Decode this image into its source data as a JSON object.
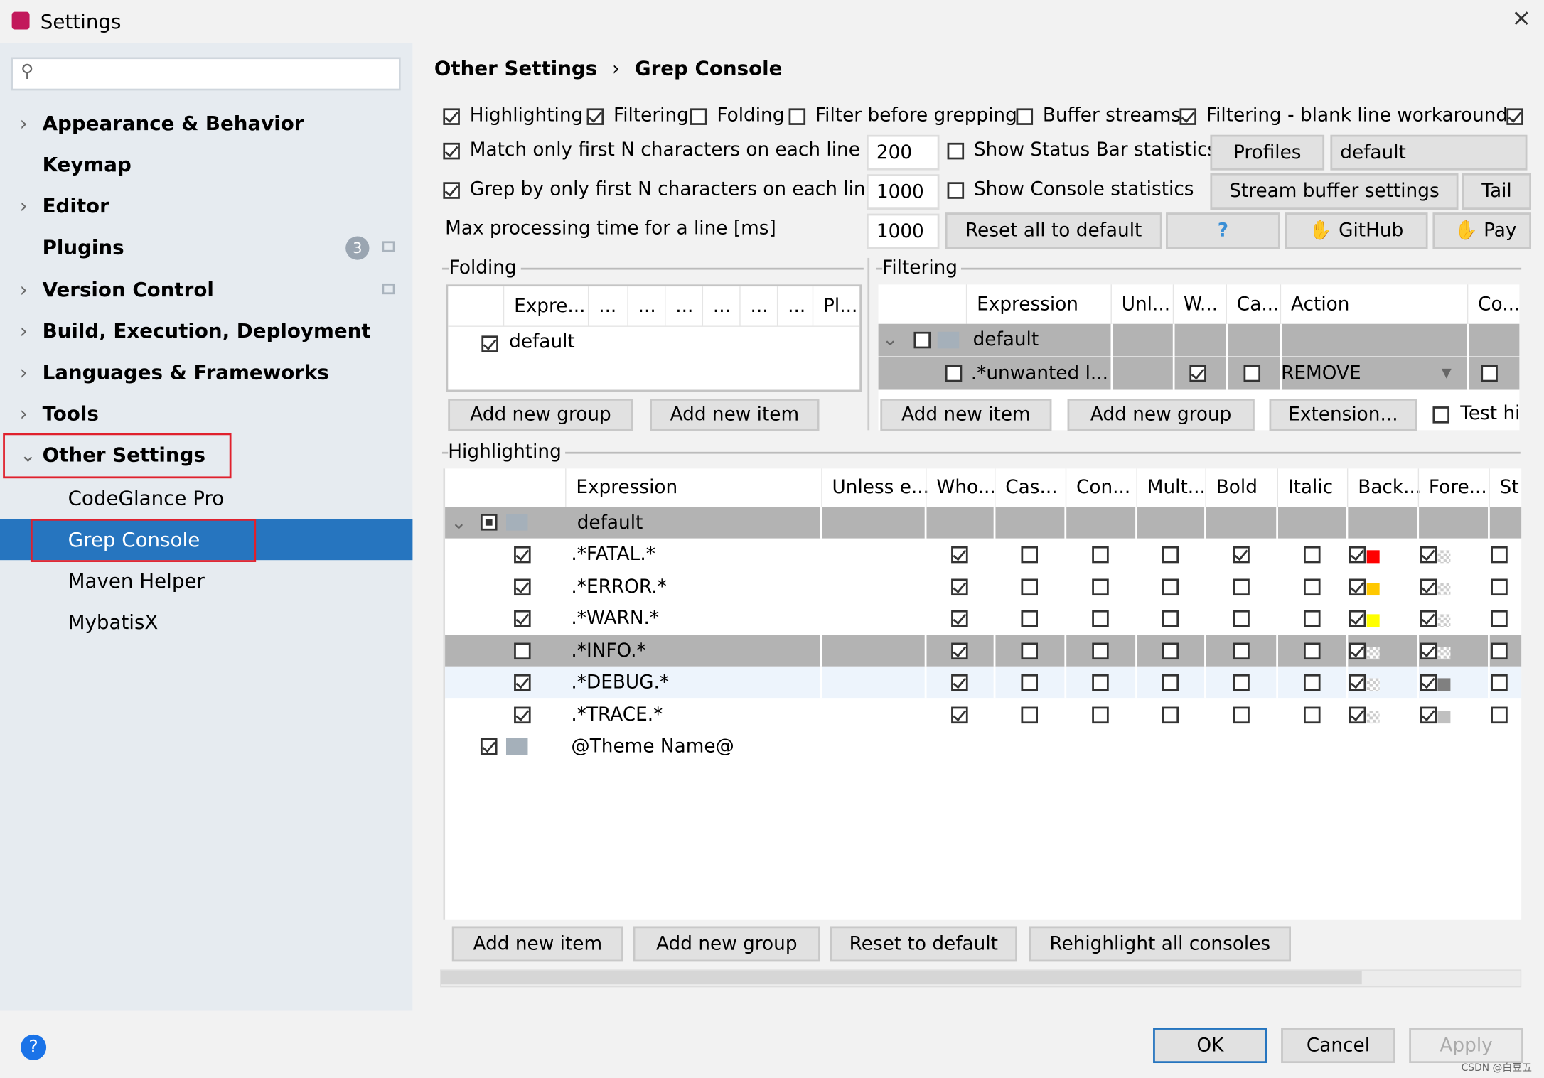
{
  "window": {
    "title": "Settings",
    "close": "×"
  },
  "sidebar": {
    "search_placeholder": "",
    "items": [
      {
        "label": "Appearance & Behavior",
        "chevron": "›"
      },
      {
        "label": "Keymap"
      },
      {
        "label": "Editor",
        "chevron": "›"
      },
      {
        "label": "Plugins",
        "badge": "3"
      },
      {
        "label": "Version Control",
        "chevron": "›"
      },
      {
        "label": "Build, Execution, Deployment",
        "chevron": "›"
      },
      {
        "label": "Languages & Frameworks",
        "chevron": "›"
      },
      {
        "label": "Tools",
        "chevron": "›"
      },
      {
        "label": "Other Settings",
        "chevron": "⌄"
      }
    ],
    "subitems": [
      "CodeGlance Pro",
      "Grep Console",
      "Maven Helper",
      "MybatisX"
    ],
    "selected": "Grep Console"
  },
  "breadcrumb": {
    "parent": "Other Settings",
    "sep": "›",
    "current": "Grep Console"
  },
  "options": {
    "row1": [
      {
        "label": "Highlighting",
        "checked": true
      },
      {
        "label": "Filtering",
        "checked": true
      },
      {
        "label": "Folding",
        "checked": false
      },
      {
        "label": "Filter before grepping",
        "checked": false
      },
      {
        "label": "Buffer streams",
        "checked": false
      },
      {
        "label": "Filtering - blank line workaround",
        "checked": true
      }
    ],
    "match_first_n": {
      "label": "Match only first N characters on each line",
      "checked": true,
      "value": "200"
    },
    "grep_first_n": {
      "label": "Grep by only first N characters on each line",
      "checked": true,
      "value": "1000"
    },
    "max_time": {
      "label": "Max processing time for a line [ms]",
      "value": "1000"
    },
    "status_bar_stats": {
      "label": "Show Status Bar statistics",
      "checked": false
    },
    "console_stats": {
      "label": "Show Console statistics",
      "checked": false
    },
    "profiles_label": "Profiles",
    "profile_value": "default",
    "stream_buffer": "Stream buffer settings",
    "tail": "Tail",
    "reset_all": "Reset all to default",
    "help": "?",
    "github": "GitHub",
    "pay": "Pay"
  },
  "folding": {
    "title": "Folding",
    "columns": [
      "Expre...",
      "...",
      "...",
      "...",
      "...",
      "...",
      "...",
      "Pl..."
    ],
    "rows": [
      {
        "label": "default",
        "checked": true
      }
    ],
    "add_group": "Add new group",
    "add_item": "Add new item"
  },
  "filtering": {
    "title": "Filtering",
    "columns": [
      "Expression",
      "Unl...",
      "W...",
      "Ca...",
      "Action",
      "Co..."
    ],
    "group": {
      "label": "default",
      "checked": false
    },
    "rows": [
      {
        "enabled": false,
        "expression": ".*unwanted l...",
        "whole": true,
        "case": false,
        "action": "REMOVE",
        "continue": false
      }
    ],
    "add_item": "Add new item",
    "add_group": "Add new group",
    "extension": "Extension...",
    "test": {
      "label": "Test hi",
      "checked": false
    }
  },
  "highlighting": {
    "title": "Highlighting",
    "columns": [
      "Expression",
      "Unless e...",
      "Who...",
      "Cas...",
      "Con...",
      "Mult...",
      "Bold",
      "Italic",
      "Back...",
      "Fore...",
      "St"
    ],
    "group": {
      "label": "default",
      "state": "partial"
    },
    "rows": [
      {
        "enabled": true,
        "expression": ".*FATAL.*",
        "flags": [
          true,
          false,
          false,
          false,
          true,
          false,
          true,
          true,
          false
        ],
        "back": "#ff0000",
        "fore": null
      },
      {
        "enabled": true,
        "expression": ".*ERROR.*",
        "flags": [
          true,
          false,
          false,
          false,
          false,
          false,
          true,
          true,
          false
        ],
        "back": "#ffc800",
        "fore": null
      },
      {
        "enabled": true,
        "expression": ".*WARN.*",
        "flags": [
          true,
          false,
          false,
          false,
          false,
          false,
          true,
          true,
          false
        ],
        "back": "#ffff00",
        "fore": null
      },
      {
        "enabled": false,
        "expression": ".*INFO.*",
        "flags": [
          true,
          false,
          false,
          false,
          false,
          false,
          true,
          true,
          false
        ],
        "back": null,
        "fore": null,
        "selected": true
      },
      {
        "enabled": true,
        "expression": ".*DEBUG.*",
        "flags": [
          true,
          false,
          false,
          false,
          false,
          false,
          true,
          true,
          false
        ],
        "back": null,
        "fore": "#808080",
        "hover": true
      },
      {
        "enabled": true,
        "expression": ".*TRACE.*",
        "flags": [
          true,
          false,
          false,
          false,
          false,
          false,
          true,
          true,
          false
        ],
        "back": null,
        "fore": "#c0c0c0"
      }
    ],
    "theme_group": {
      "label": "@Theme Name@",
      "checked": true
    },
    "buttons": [
      "Add new item",
      "Add new group",
      "Reset to default",
      "Rehighlight all consoles"
    ]
  },
  "footer": {
    "ok": "OK",
    "cancel": "Cancel",
    "apply": "Apply",
    "help": "?",
    "watermark": "CSDN @白豆五"
  },
  "colors": {
    "selection": "#2675bf",
    "accent_border": "#e0202c",
    "row_selected": "#b3b3b3"
  }
}
